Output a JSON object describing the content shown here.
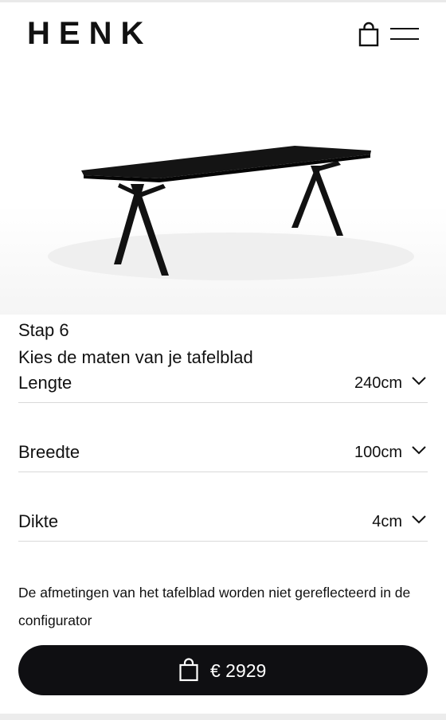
{
  "header": {
    "logo": "HENK",
    "icons": {
      "cart": "shopping-bag-icon",
      "menu": "hamburger-menu-icon"
    }
  },
  "hero": {
    "image": "black-table-render"
  },
  "configurator": {
    "step_label": "Stap 6",
    "step_title": "Kies de maten van je tafelblad",
    "options": [
      {
        "label": "Lengte",
        "value": "240cm"
      },
      {
        "label": "Breedte",
        "value": "100cm"
      },
      {
        "label": "Dikte",
        "value": "4cm"
      }
    ],
    "note": "De afmetingen van het tafelblad worden niet gereflecteerd in de configurator"
  },
  "cta": {
    "price": "€ 2929",
    "icon": "shopping-bag-icon"
  },
  "colors": {
    "primary": "#0f0f12",
    "text": "#111111",
    "divider": "#d9d9d9"
  }
}
